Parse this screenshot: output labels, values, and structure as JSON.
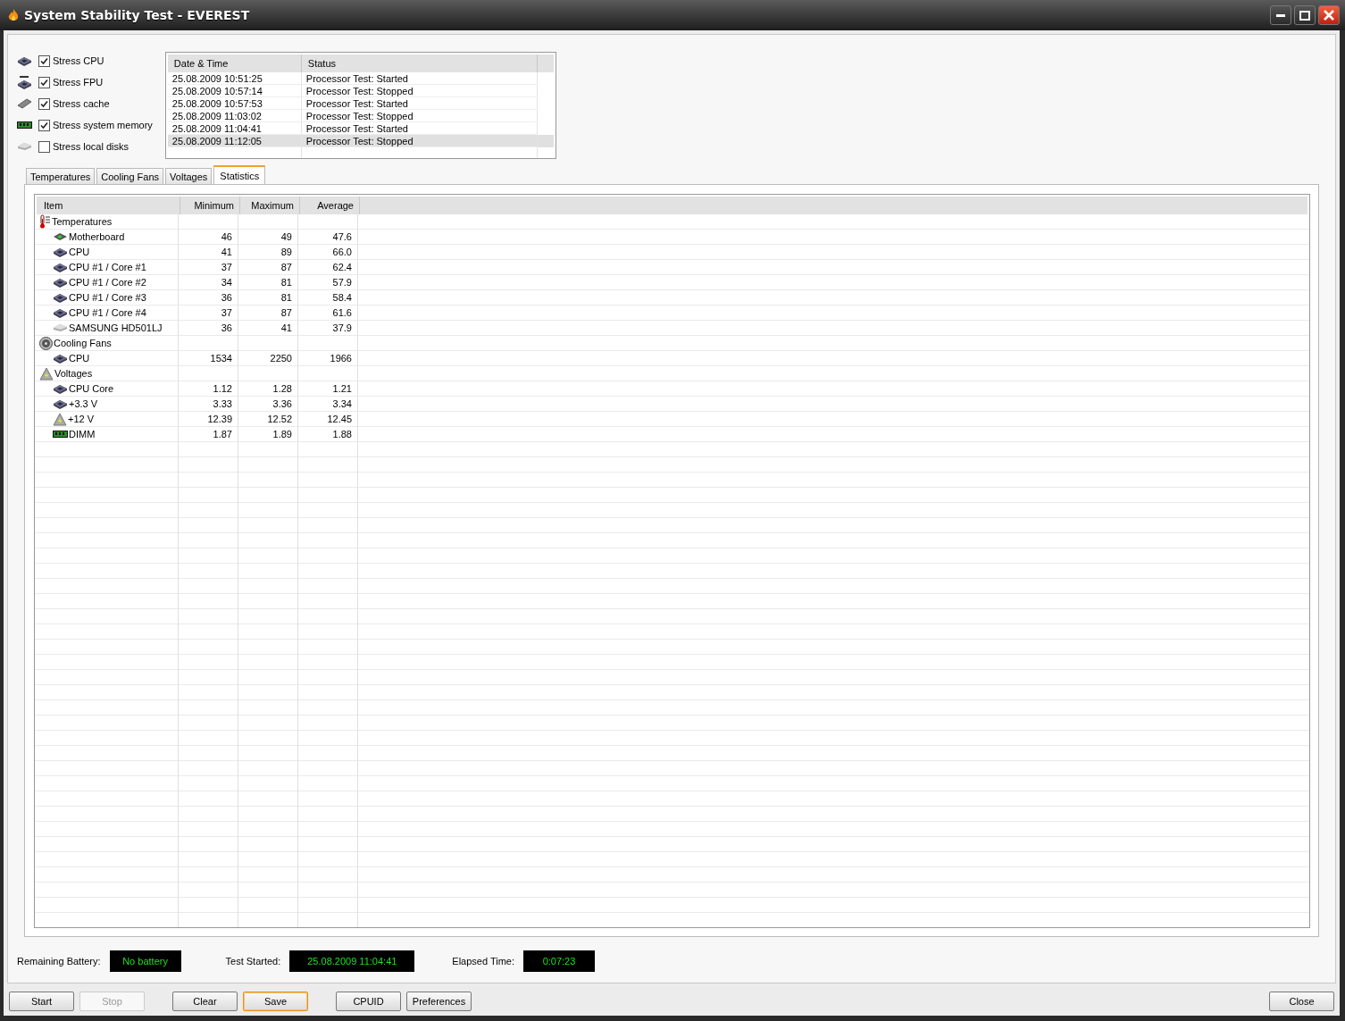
{
  "window": {
    "title": "System Stability Test - EVEREST"
  },
  "stress_options": [
    {
      "label": "Stress CPU",
      "kind": "chip",
      "checked": true
    },
    {
      "label": "Stress FPU",
      "kind": "fpu",
      "checked": true
    },
    {
      "label": "Stress cache",
      "kind": "cache",
      "checked": true
    },
    {
      "label": "Stress system memory",
      "kind": "memory",
      "checked": true
    },
    {
      "label": "Stress local disks",
      "kind": "disk",
      "checked": false
    }
  ],
  "log": {
    "columns": [
      "Date & Time",
      "Status"
    ],
    "rows": [
      {
        "date_time": "25.08.2009 10:51:25",
        "status": "Processor Test: Started",
        "selected": false
      },
      {
        "date_time": "25.08.2009 10:57:14",
        "status": "Processor Test: Stopped",
        "selected": false
      },
      {
        "date_time": "25.08.2009 10:57:53",
        "status": "Processor Test: Started",
        "selected": false
      },
      {
        "date_time": "25.08.2009 11:03:02",
        "status": "Processor Test: Stopped",
        "selected": false
      },
      {
        "date_time": "25.08.2009 11:04:41",
        "status": "Processor Test: Started",
        "selected": false
      },
      {
        "date_time": "25.08.2009 11:12:05",
        "status": "Processor Test: Stopped",
        "selected": true
      }
    ]
  },
  "tabs": [
    {
      "label": "Temperatures",
      "selected": false
    },
    {
      "label": "Cooling Fans",
      "selected": false
    },
    {
      "label": "Voltages",
      "selected": false
    },
    {
      "label": "Statistics",
      "selected": true
    }
  ],
  "statistics": {
    "columns": [
      "Item",
      "Minimum",
      "Maximum",
      "Average"
    ],
    "groups": [
      {
        "label": "Temperatures",
        "kind": "thermometer",
        "children": [
          {
            "label": "Motherboard",
            "kind": "motherboard",
            "minimum": "46",
            "maximum": "49",
            "average": "47.6"
          },
          {
            "label": "CPU",
            "kind": "chip",
            "minimum": "41",
            "maximum": "89",
            "average": "66.0"
          },
          {
            "label": "CPU #1 / Core #1",
            "kind": "chip",
            "minimum": "37",
            "maximum": "87",
            "average": "62.4"
          },
          {
            "label": "CPU #1 / Core #2",
            "kind": "chip",
            "minimum": "34",
            "maximum": "81",
            "average": "57.9"
          },
          {
            "label": "CPU #1 / Core #3",
            "kind": "chip",
            "minimum": "36",
            "maximum": "81",
            "average": "58.4"
          },
          {
            "label": "CPU #1 / Core #4",
            "kind": "chip",
            "minimum": "37",
            "maximum": "87",
            "average": "61.6"
          },
          {
            "label": "SAMSUNG HD501LJ",
            "kind": "disk",
            "minimum": "36",
            "maximum": "41",
            "average": "37.9"
          }
        ]
      },
      {
        "label": "Cooling Fans",
        "kind": "fan",
        "children": [
          {
            "label": "CPU",
            "kind": "chip",
            "minimum": "1534",
            "maximum": "2250",
            "average": "1966"
          }
        ]
      },
      {
        "label": "Voltages",
        "kind": "voltage",
        "children": [
          {
            "label": "CPU Core",
            "kind": "chip",
            "minimum": "1.12",
            "maximum": "1.28",
            "average": "1.21"
          },
          {
            "label": "+3.3 V",
            "kind": "chip",
            "minimum": "3.33",
            "maximum": "3.36",
            "average": "3.34"
          },
          {
            "label": "+12 V",
            "kind": "voltage",
            "minimum": "12.39",
            "maximum": "12.52",
            "average": "12.45"
          },
          {
            "label": "DIMM",
            "kind": "memory",
            "minimum": "1.87",
            "maximum": "1.89",
            "average": "1.88"
          }
        ]
      }
    ]
  },
  "status": [
    {
      "label": "Remaining Battery:",
      "value": "No battery"
    },
    {
      "label": "Test Started:",
      "value": "25.08.2009 11:04:41"
    },
    {
      "label": "Elapsed Time:",
      "value": "0:07:23"
    }
  ],
  "buttons": [
    {
      "label": "Start",
      "disabled": false,
      "focused": false
    },
    {
      "label": "Stop",
      "disabled": true,
      "focused": false
    },
    {
      "label": "Clear",
      "disabled": false,
      "focused": false
    },
    {
      "label": "Save",
      "disabled": false,
      "focused": true
    },
    {
      "label": "CPUID",
      "disabled": false,
      "focused": false
    },
    {
      "label": "Preferences",
      "disabled": false,
      "focused": false
    }
  ],
  "close_button": {
    "label": "Close"
  }
}
